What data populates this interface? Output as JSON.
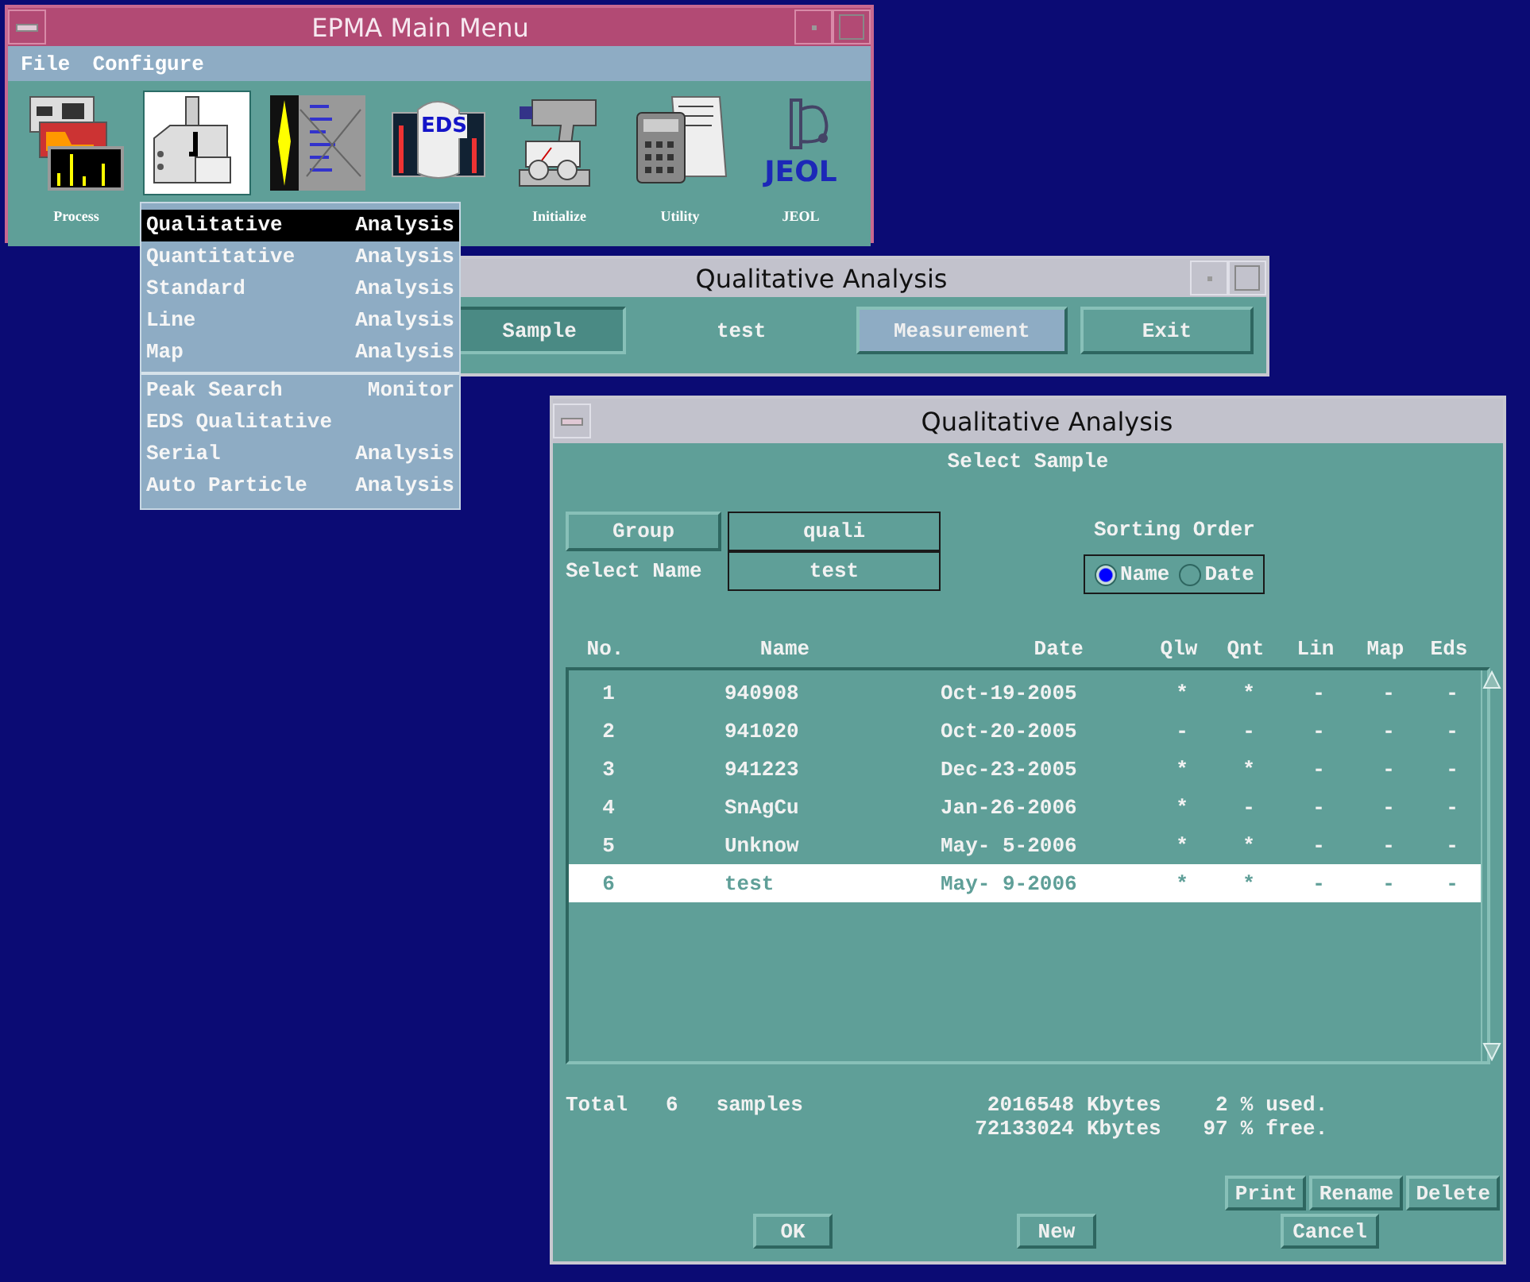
{
  "main_menu": {
    "title": "EPMA Main Menu",
    "menu": [
      "File",
      "Configure"
    ],
    "tools": [
      {
        "kind": "charts",
        "label": "Process",
        "selected": false
      },
      {
        "kind": "instrument",
        "selected": true
      },
      {
        "kind": "scan",
        "selected": false
      },
      {
        "kind": "eds",
        "icon_text": "EDS",
        "selected": false
      },
      {
        "kind": "gun",
        "label": "Initialize",
        "selected": false
      },
      {
        "kind": "calculator",
        "label": "Utility",
        "selected": false
      },
      {
        "kind": "logo",
        "icon_text": "JEOL",
        "label": "JEOL",
        "selected": false
      }
    ]
  },
  "dropdown": {
    "items": [
      {
        "label": "Qualitative",
        "suffix": "Analysis",
        "selected": true,
        "separator_before": false
      },
      {
        "label": "Quantitative",
        "suffix": "Analysis",
        "selected": false,
        "separator_before": false
      },
      {
        "label": "Standard",
        "suffix": "Analysis",
        "selected": false,
        "separator_before": false
      },
      {
        "label": "Line",
        "suffix": "Analysis",
        "selected": false,
        "separator_before": false
      },
      {
        "label": "Map",
        "suffix": "Analysis",
        "selected": false,
        "separator_before": false
      },
      {
        "label": "Peak Search",
        "suffix": "Monitor",
        "selected": false,
        "separator_before": true
      },
      {
        "label": "EDS Qualitative",
        "selected": false,
        "separator_before": false
      },
      {
        "label": "Serial",
        "suffix": "Analysis",
        "selected": false,
        "separator_before": false
      },
      {
        "label": "Auto Particle",
        "suffix": "Analysis",
        "selected": false,
        "separator_before": false
      }
    ]
  },
  "qual_window": {
    "title": "Qualitative Analysis",
    "controls": [
      {
        "kind": "pressed",
        "label": "Sample"
      },
      {
        "kind": "value",
        "label": "test"
      },
      {
        "kind": "accent",
        "label": "Measurement"
      },
      {
        "kind": "plain",
        "label": "Exit"
      }
    ]
  },
  "dialog": {
    "title": "Qualitative Analysis",
    "subtitle": "Select Sample",
    "group": {
      "button": "Group",
      "value": "quali"
    },
    "select_name": {
      "label": "Select Name",
      "value": "test"
    },
    "sorting": {
      "label": "Sorting Order",
      "options": [
        {
          "label": "Name",
          "selected": true
        },
        {
          "label": "Date",
          "selected": false
        }
      ]
    },
    "table": {
      "columns": [
        "No.",
        "Name",
        "Date",
        "Qlw",
        "Qnt",
        "Lin",
        "Map",
        "Eds"
      ],
      "rows": [
        {
          "selected": false,
          "cells": [
            "1",
            "940908",
            "Oct-19-2005",
            "*",
            "*",
            "-",
            "-",
            "-"
          ]
        },
        {
          "selected": false,
          "cells": [
            "2",
            "941020",
            "Oct-20-2005",
            "-",
            "-",
            "-",
            "-",
            "-"
          ]
        },
        {
          "selected": false,
          "cells": [
            "3",
            "941223",
            "Dec-23-2005",
            "*",
            "*",
            "-",
            "-",
            "-"
          ]
        },
        {
          "selected": false,
          "cells": [
            "4",
            "SnAgCu",
            "Jan-26-2006",
            "*",
            "-",
            "-",
            "-",
            "-"
          ]
        },
        {
          "selected": false,
          "cells": [
            "5",
            "Unknow",
            "May- 5-2006",
            "*",
            "*",
            "-",
            "-",
            "-"
          ]
        },
        {
          "selected": true,
          "cells": [
            "6",
            "test",
            "May- 9-2006",
            "*",
            "*",
            "-",
            "-",
            "-"
          ]
        }
      ]
    },
    "total": {
      "label": "Total",
      "count": "6",
      "unit": "samples"
    },
    "storage": [
      {
        "amount": "2016548",
        "unit": "Kbytes",
        "percent": "2",
        "sign": "%",
        "status": "used."
      },
      {
        "amount": "72133024",
        "unit": "Kbytes",
        "percent": "97",
        "sign": "%",
        "status": "free."
      }
    ],
    "file_buttons": [
      "Print",
      "Rename",
      "Delete"
    ],
    "buttons": {
      "ok": "OK",
      "new": "New",
      "cancel": "Cancel"
    }
  }
}
